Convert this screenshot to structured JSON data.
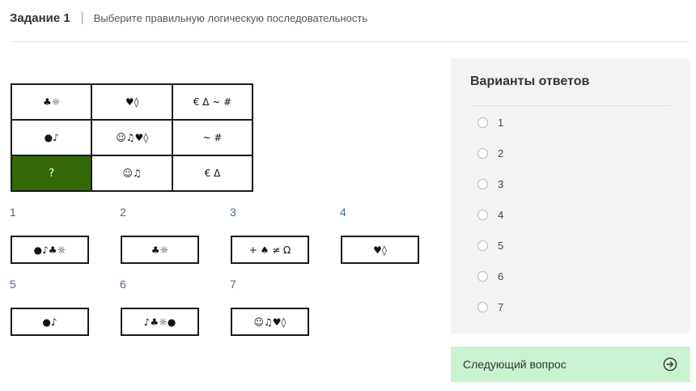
{
  "header": {
    "task_title": "Задание 1",
    "task_desc": "Выберите правильную логическую последовательность"
  },
  "grid": {
    "rows": [
      [
        "♣☼",
        "♥◊",
        "€ Δ ~ #"
      ],
      [
        "●♪",
        "☺♫♥◊",
        "~ #"
      ],
      [
        "?",
        "☺♫",
        "€ Δ"
      ]
    ]
  },
  "options": [
    {
      "number": "1",
      "content": "●♪♣☼"
    },
    {
      "number": "2",
      "content": "♣☼"
    },
    {
      "number": "3",
      "content": "+ ♠ ≠ Ω"
    },
    {
      "number": "4",
      "content": "♥◊"
    },
    {
      "number": "5",
      "content": "●♪"
    },
    {
      "number": "6",
      "content": "♪♣☼●"
    },
    {
      "number": "7",
      "content": "☺♫♥◊"
    }
  ],
  "answers": {
    "title": "Варианты ответов",
    "items": [
      "1",
      "2",
      "3",
      "4",
      "5",
      "6",
      "7"
    ]
  },
  "next_button": {
    "label": "Следующий вопрос",
    "icon": "arrow-right-circle-icon"
  },
  "colors": {
    "question_cell": "#356807",
    "next_button_bg": "#c9f3d0",
    "answers_panel_bg": "#f4f4f4"
  }
}
